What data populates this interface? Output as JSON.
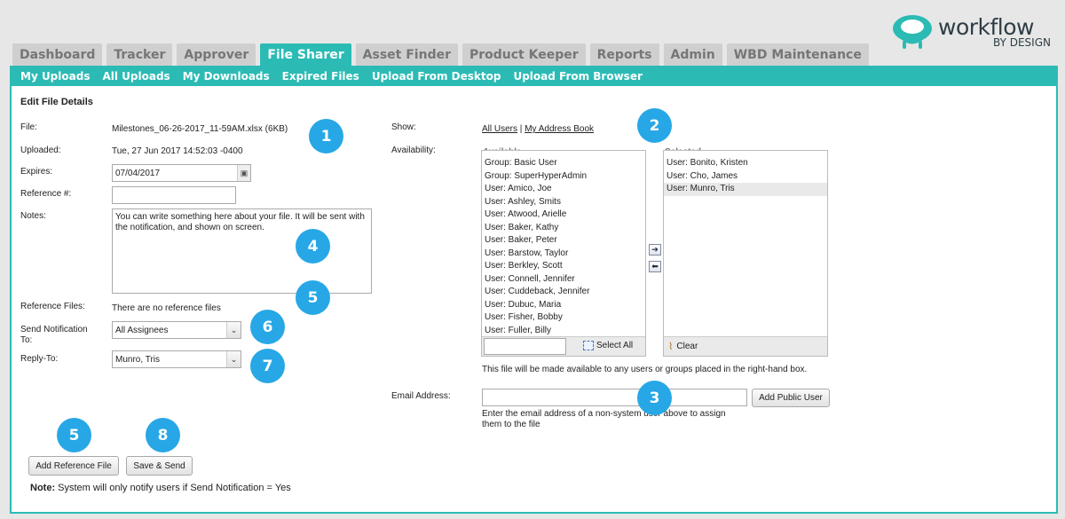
{
  "brand": {
    "word": "workflow",
    "sub": "BY DESIGN"
  },
  "tabs": [
    "Dashboard",
    "Tracker",
    "Approver",
    "File Sharer",
    "Asset Finder",
    "Product Keeper",
    "Reports",
    "Admin",
    "WBD Maintenance"
  ],
  "active_tab": "File Sharer",
  "subnav": [
    "My Uploads",
    "All Uploads",
    "My Downloads",
    "Expired Files",
    "Upload From Desktop",
    "Upload From Browser"
  ],
  "form": {
    "title": "Edit File Details",
    "file_label": "File:",
    "file_value": "Milestones_06-26-2017_11-59AM.xlsx (6KB)",
    "uploaded_label": "Uploaded:",
    "uploaded_value": "Tue, 27 Jun 2017 14:52:03 -0400",
    "expires_label": "Expires:",
    "expires_value": "07/04/2017",
    "reference_label": "Reference #:",
    "reference_value": "",
    "notes_label": "Notes:",
    "notes_value": "You can write something here about your file. It will be sent with the notification, and shown on screen.",
    "ref_files_label": "Reference Files:",
    "ref_files_value": "There are no reference files",
    "send_notif_label_1": "Send Notification",
    "send_notif_label_2": "To:",
    "send_notif_value": "All Assignees",
    "reply_to_label": "Reply-To:",
    "reply_to_value": "Munro, Tris",
    "add_ref_button": "Add Reference File",
    "save_button": "Save & Send",
    "note_bold": "Note:",
    "note_text": " System will only notify users if Send Notification = Yes"
  },
  "right": {
    "show_label": "Show:",
    "show_all": "All Users",
    "show_sep": "|",
    "show_book": "My Address Book",
    "availability_label": "Availability:",
    "available_header": "Available",
    "selected_header": "Selected",
    "available_items": [
      "Group: Basic User",
      "Group: SuperHyperAdmin",
      "User: Amico, Joe",
      "User: Ashley, Smits",
      "User: Atwood, Arielle",
      "User: Baker, Kathy",
      "User: Baker, Peter",
      "User: Barstow, Taylor",
      "User: Berkley, Scott",
      "User: Connell, Jennifer",
      "User: Cuddeback, Jennifer",
      "User: Dubuc, Maria",
      "User: Fisher, Bobby",
      "User: Fuller, Billy"
    ],
    "selected_items": [
      "User: Bonito, Kristen",
      "User: Cho, James",
      "User: Munro, Tris"
    ],
    "select_all": "Select All",
    "clear": "Clear",
    "availability_note": "This file will be made available to any users or groups placed in the right-hand box.",
    "email_label": "Email Address:",
    "email_value": "",
    "add_public_user": "Add Public User",
    "email_help_1": "Enter the email address of a non-system user above to assign",
    "email_help_2": "them to the file"
  },
  "markers": [
    "1",
    "2",
    "3",
    "4",
    "5",
    "6",
    "7",
    "5",
    "8"
  ],
  "colors": {
    "accent": "#2bbbb4",
    "marker": "#27a7e6"
  }
}
